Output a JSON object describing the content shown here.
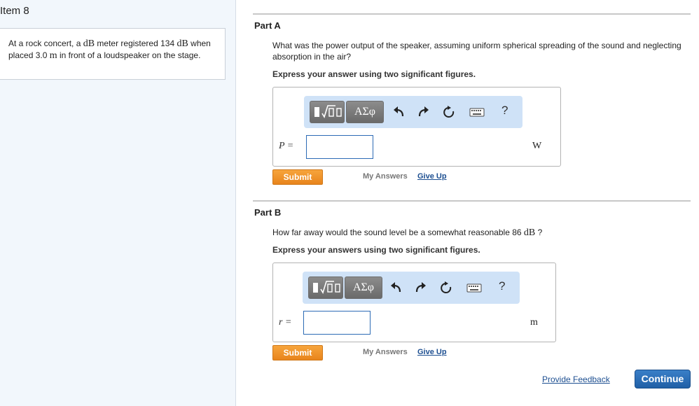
{
  "item": {
    "title": "Item 8"
  },
  "problem": {
    "text_1": "At a rock concert, a ",
    "unit_db": "dB",
    "text_2": " meter registered 134 ",
    "text_3": " when placed 3.0 ",
    "unit_m": "m",
    "text_4": " in front of a loudspeaker on the stage."
  },
  "toolbar": {
    "symbols_label": "ΑΣφ",
    "help_label": "?"
  },
  "part_a": {
    "title": "Part A",
    "question": "What was the power output of the speaker, assuming uniform spherical spreading of the sound and neglecting absorption in the air?",
    "instruction": "Express your answer using two significant figures.",
    "variable_label": "P =",
    "input_value": "",
    "unit": "W",
    "submit_label": "Submit",
    "my_answers_label": "My Answers",
    "give_up_label": "Give Up"
  },
  "part_b": {
    "title": "Part B",
    "question_1": "How far away would the sound level be a somewhat reasonable 86 ",
    "question_unit": "dB",
    "question_2": " ?",
    "instruction": "Express your answers using two significant figures.",
    "variable_label": "r =",
    "input_value": "",
    "unit": "m",
    "submit_label": "Submit",
    "my_answers_label": "My Answers",
    "give_up_label": "Give Up"
  },
  "footer": {
    "feedback_label": "Provide Feedback",
    "continue_label": "Continue"
  },
  "colors": {
    "toolbar_bg": "#cfe2f7",
    "submit": "#f0941f",
    "continue": "#2a6db8",
    "link": "#1d4f91",
    "left_pane_bg": "#f2f7fc"
  },
  "icons": [
    "templates-icon",
    "undo-icon",
    "redo-icon",
    "reset-icon",
    "keyboard-icon",
    "help-icon"
  ]
}
